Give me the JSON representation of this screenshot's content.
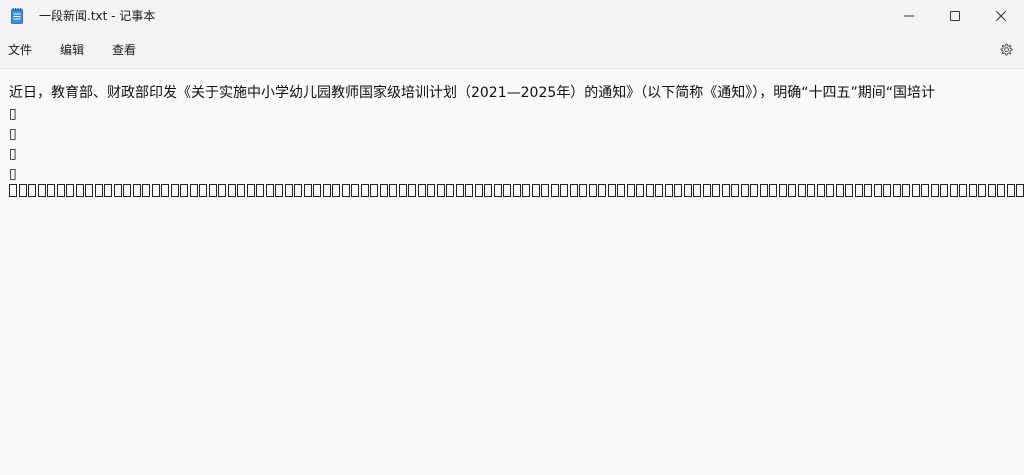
{
  "window": {
    "title": "一段新闻.txt - 记事本",
    "icons": {
      "app": "notepad-icon",
      "minimize": "minimize-icon",
      "maximize": "maximize-icon",
      "close": "close-icon",
      "settings": "gear-icon"
    }
  },
  "menu": {
    "file": "文件",
    "edit": "编辑",
    "view": "查看"
  },
  "editor": {
    "line1": "近日，教育部、财政部印发《关于实施中小学幼儿园教师国家级培训计划（2021—2025年）的通知》（以下简称《通知》），明确“十四五”期间“国培计",
    "line2": "▯",
    "line3": "▯",
    "line4": "▯",
    "line5": "▯",
    "tofu_count": 112
  },
  "colors": {
    "titlebar_bg": "#f3f3f3",
    "editor_bg": "#f9f9f9",
    "accent": "#1a6fd1"
  }
}
